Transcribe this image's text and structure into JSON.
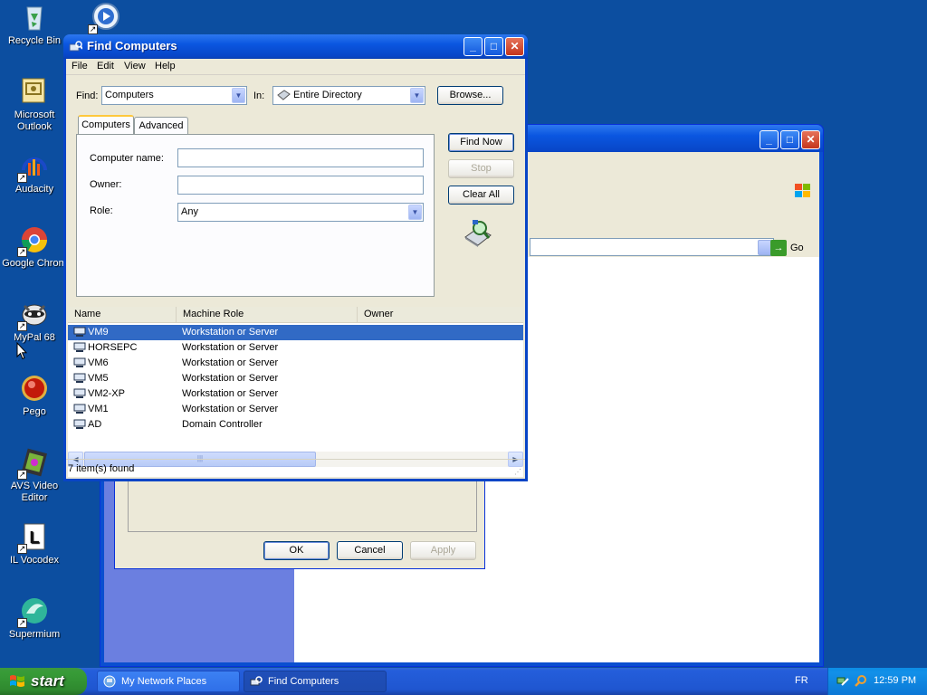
{
  "desktop": {
    "icons": [
      {
        "label": "Recycle Bin",
        "icon": "recycle-bin-icon"
      },
      {
        "label": "Microsoft\nOutlook",
        "icon": "outlook-icon"
      },
      {
        "label": "Audacity",
        "icon": "audacity-icon"
      },
      {
        "label": "Google Chrom",
        "icon": "chrome-icon"
      },
      {
        "label": "MyPal 68",
        "icon": "mypal-icon"
      },
      {
        "label": "Pego",
        "icon": "pego-icon"
      },
      {
        "label": "AVS Video\nEditor",
        "icon": "avs-video-editor-icon"
      },
      {
        "label": "IL Vocodex",
        "icon": "vocodex-icon"
      },
      {
        "label": "Supermium",
        "icon": "supermium-icon"
      }
    ]
  },
  "find_window": {
    "title": "Find Computers",
    "menu": [
      "File",
      "Edit",
      "View",
      "Help"
    ],
    "find_label": "Find:",
    "find_value": "Computers",
    "in_label": "In:",
    "in_value": "Entire Directory",
    "browse_label": "Browse...",
    "tabs": [
      "Computers",
      "Advanced"
    ],
    "active_tab": "Computers",
    "fields": {
      "computer_name_label": "Computer name:",
      "computer_name_value": "",
      "owner_label": "Owner:",
      "owner_value": "",
      "role_label": "Role:",
      "role_value": "Any"
    },
    "buttons": {
      "find_now": "Find Now",
      "stop": "Stop",
      "clear_all": "Clear All"
    },
    "columns": [
      "Name",
      "Machine Role",
      "Owner"
    ],
    "rows": [
      {
        "name": "VM9",
        "role": "Workstation or Server",
        "owner": "",
        "selected": true
      },
      {
        "name": "HORSEPC",
        "role": "Workstation or Server",
        "owner": ""
      },
      {
        "name": "VM6",
        "role": "Workstation or Server",
        "owner": ""
      },
      {
        "name": "VM5",
        "role": "Workstation or Server",
        "owner": ""
      },
      {
        "name": "VM2-XP",
        "role": "Workstation or Server",
        "owner": ""
      },
      {
        "name": "VM1",
        "role": "Workstation or Server",
        "owner": ""
      },
      {
        "name": "AD",
        "role": "Domain Controller",
        "owner": ""
      }
    ],
    "status": "7 item(s) found"
  },
  "background_window": {
    "go_label": "Go"
  },
  "properties_dialog": {
    "ok": "OK",
    "cancel": "Cancel",
    "apply": "Apply"
  },
  "taskbar": {
    "start": "start",
    "tasks": [
      {
        "label": "My Network Places",
        "icon": "network-places-icon",
        "active": false
      },
      {
        "label": "Find Computers",
        "icon": "find-computers-icon",
        "active": true
      }
    ],
    "language": "FR",
    "clock": "12:59 PM"
  },
  "colors": {
    "desktop": "#0c4ea0",
    "selection": "#316ac5",
    "titlebar": "#0a56e0",
    "start_green": "#379b37"
  }
}
